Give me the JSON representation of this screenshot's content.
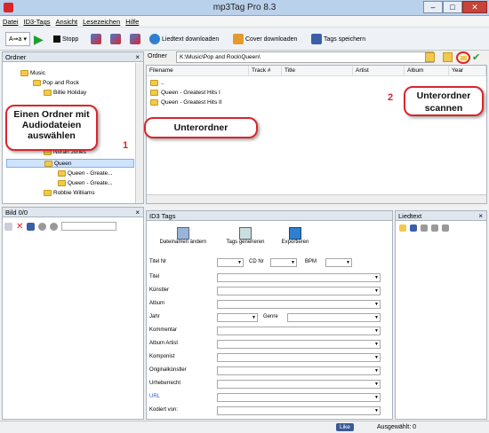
{
  "window": {
    "title": "mp3Tag Pro 8.3"
  },
  "menu": [
    "Datei",
    "ID3-Tags",
    "Ansicht",
    "Lesezeichen",
    "Hilfe"
  ],
  "toolbar": {
    "stop_label": "Stopp",
    "lyrics_label": "Liedtext downloaden",
    "cover_label": "Cover downloaden",
    "save_label": "Tags speichern",
    "case_label": "A⇒a"
  },
  "folder_panel": {
    "title": "Ordner"
  },
  "folder_bar": {
    "label": "Ordner",
    "path": "K:\\Music\\Pop and Rock\\Queen\\"
  },
  "tree": [
    {
      "label": "Music",
      "indent": 1
    },
    {
      "label": "Pop and Rock",
      "indent": 2
    },
    {
      "label": "Billie Holiday",
      "indent": 3
    },
    {
      "label": "Norah Jones",
      "indent": 3
    },
    {
      "label": "Queen",
      "indent": 3
    },
    {
      "label": "Queen - Greate...",
      "indent": 4
    },
    {
      "label": "Queen - Greate...",
      "indent": 4
    },
    {
      "label": "Robbie Williams",
      "indent": 3
    }
  ],
  "file_table": {
    "columns": [
      "Filename",
      "Track #",
      "Title",
      "Artist",
      "Album",
      "Year"
    ],
    "rows": [
      "..",
      "Queen - Greatest Hits I",
      "Queen - Greatest Hits II"
    ]
  },
  "image_panel": {
    "title": "Bild 0/0"
  },
  "tags_panel": {
    "title": "ID3 Tags",
    "rename_label": "Dateinamen ändern",
    "generate_label": "Tags generieren",
    "export_label": "Exportieren",
    "fields": {
      "track": "Titel Nr",
      "cd": "CD Nr",
      "bpm": "BPM",
      "title": "Titel",
      "artist": "Künstler",
      "album": "Album",
      "year": "Jahr",
      "genre": "Genre",
      "comment": "Kommentar",
      "album_artist": "Album Artist",
      "composer": "Komponist",
      "orig_artist": "Originalkünstler",
      "copyright": "Urheberrecht",
      "url": "URL",
      "encoded_by": "Kodiert von:"
    }
  },
  "lyrics_panel": {
    "title": "Liedtext"
  },
  "callouts": {
    "select_folder": "Einen Ordner mit Audiodateien auswählen",
    "subfolder": "Unterordner",
    "scan_subfolders": "Unterordner scannen",
    "marker1": "1",
    "marker2": "2"
  },
  "status": {
    "like": "Like",
    "selected": "Ausgewählt: 0"
  },
  "colors": {
    "accent": "#d9262b",
    "folder": "#f2c94c",
    "panel_header": "#dfe6ee"
  }
}
